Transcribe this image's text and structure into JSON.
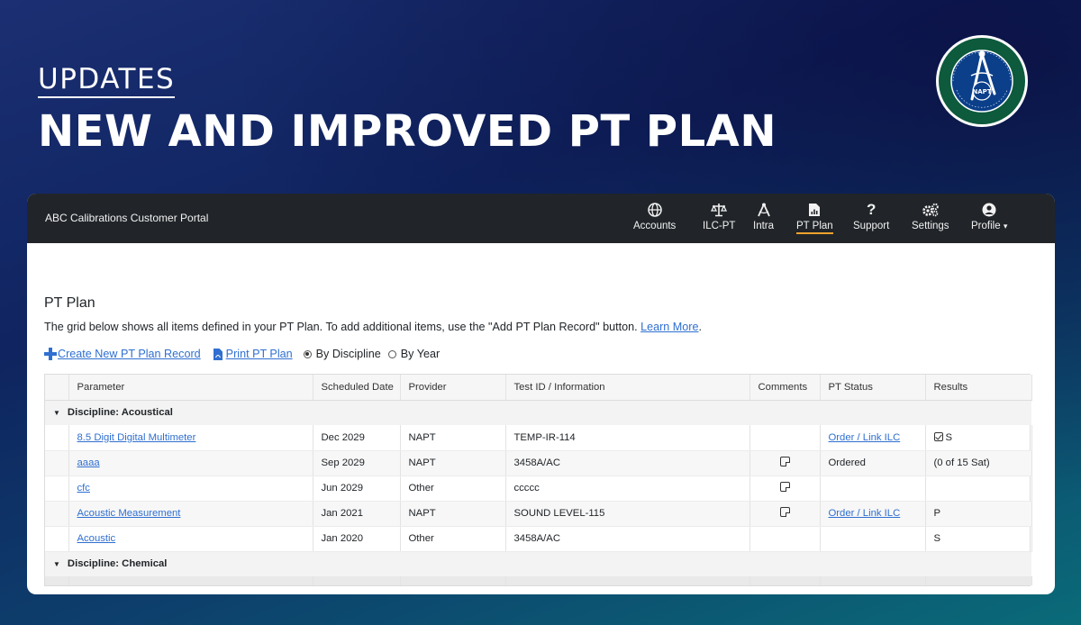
{
  "hero": {
    "kicker": "UPDATES",
    "title": "NEW AND IMPROVED PT PLAN"
  },
  "logo": {
    "name": "NAPT",
    "ring_text": "NATIONAL ASSOCIATION FOR PROFICIENCY TESTING"
  },
  "portal": {
    "brand": "ABC Calibrations Customer Portal",
    "nav": [
      {
        "label": "Accounts",
        "icon": "globe-icon"
      },
      {
        "label": "ILC-PT",
        "icon": "scale-icon"
      },
      {
        "label": "Intra",
        "icon": "compass-icon"
      },
      {
        "label": "PT Plan",
        "icon": "chart-file-icon",
        "active": true
      },
      {
        "label": "Support",
        "icon": "question-icon"
      },
      {
        "label": "Settings",
        "icon": "cogs-icon"
      },
      {
        "label": "Profile",
        "icon": "user-circle-icon",
        "caret": "▾"
      }
    ],
    "page_title": "PT Plan",
    "lead_text": "The grid below shows all items defined in your PT Plan. To add additional items, use the \"Add PT Plan Record\" button.",
    "learn_more": "Learn More",
    "lead_end": ".",
    "create_link": "Create New PT Plan Record",
    "print_link": "Print PT Plan",
    "radio_discipline": "By Discipline",
    "radio_year": "By Year",
    "radio_selected": "By Discipline",
    "columns": [
      "Parameter",
      "Scheduled Date",
      "Provider",
      "Test ID / Information",
      "Comments",
      "PT Status",
      "Results"
    ],
    "groups": [
      {
        "label": "Discipline: Acoustical",
        "rows": [
          {
            "parameter": "8.5 Digit Digital Multimeter",
            "date": "Dec 2029",
            "provider": "NAPT",
            "test_id": "TEMP-IR-114",
            "comment": false,
            "status": "Order / Link ILC",
            "status_link": true,
            "result": "S",
            "result_check": true
          },
          {
            "parameter": "aaaa",
            "date": "Sep 2029",
            "provider": "NAPT",
            "test_id": "3458A/AC",
            "comment": true,
            "status": "Ordered",
            "status_link": false,
            "result": "(0 of 15 Sat)",
            "result_check": false
          },
          {
            "parameter": "cfc",
            "date": "Jun 2029",
            "provider": "Other",
            "test_id": "ccccc",
            "comment": true,
            "status": "",
            "status_link": false,
            "result": "",
            "result_check": false
          },
          {
            "parameter": "Acoustic Measurement",
            "date": "Jan 2021",
            "provider": "NAPT",
            "test_id": "SOUND LEVEL-115",
            "comment": true,
            "status": "Order / Link ILC",
            "status_link": true,
            "result": "P",
            "result_check": false
          },
          {
            "parameter": "Acoustic",
            "date": "Jan 2020",
            "provider": "Other",
            "test_id": "3458A/AC",
            "comment": false,
            "status": "",
            "status_link": false,
            "result": "S",
            "result_check": false
          }
        ]
      },
      {
        "label": "Discipline: Chemical",
        "rows": []
      }
    ],
    "colors": {
      "navbar": "#212529",
      "link": "#2f6fd1",
      "active_underline": "#f0a22c"
    }
  }
}
